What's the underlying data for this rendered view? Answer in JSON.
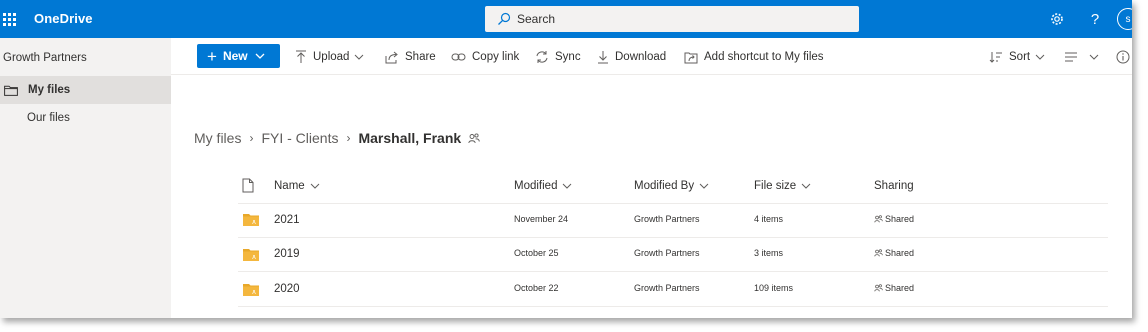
{
  "header": {
    "app_name": "OneDrive",
    "search_placeholder": "Search",
    "avatar_initial": "s",
    "help_label": "?"
  },
  "sidebar": {
    "org_name": "Growth Partners",
    "items": [
      {
        "label": "My files",
        "selected": true
      },
      {
        "label": "Our files",
        "selected": false
      }
    ]
  },
  "commands": {
    "new": "New",
    "upload": "Upload",
    "share": "Share",
    "copy_link": "Copy link",
    "sync": "Sync",
    "download": "Download",
    "add_shortcut": "Add shortcut to My files",
    "sort": "Sort"
  },
  "breadcrumb": {
    "items": [
      "My files",
      "FYI - Clients"
    ],
    "current": "Marshall, Frank"
  },
  "list": {
    "columns": {
      "name": "Name",
      "modified": "Modified",
      "modified_by": "Modified By",
      "file_size": "File size",
      "sharing": "Sharing"
    },
    "rows": [
      {
        "name": "2021",
        "modified": "November 24",
        "modified_by": "Growth Partners",
        "file_size": "4 items",
        "sharing": "Shared"
      },
      {
        "name": "2019",
        "modified": "October 25",
        "modified_by": "Growth Partners",
        "file_size": "3 items",
        "sharing": "Shared"
      },
      {
        "name": "2020",
        "modified": "October 22",
        "modified_by": "Growth Partners",
        "file_size": "109 items",
        "sharing": "Shared"
      }
    ]
  },
  "colors": {
    "brand": "#0078d4",
    "nav_background": "#f3f2f1",
    "nav_selected": "#e1dfdd",
    "folder": "#f4b73e"
  }
}
